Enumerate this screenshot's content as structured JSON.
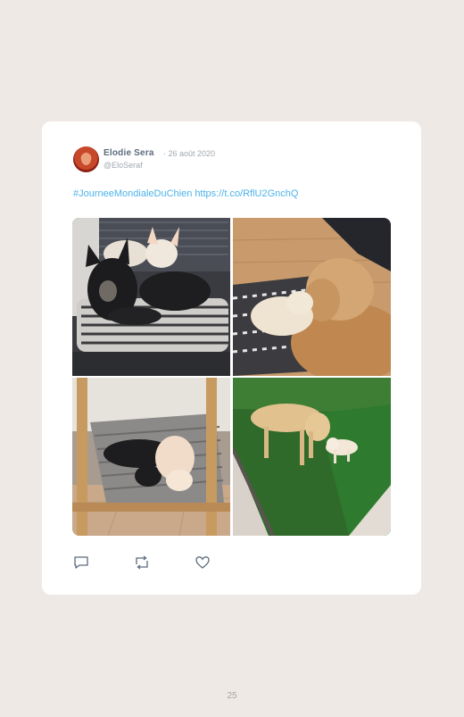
{
  "tweet": {
    "author_name": "Elodie Sera",
    "date": "· 26 août 2020",
    "handle": "@EloSeraf",
    "hashtag": "#JourneeMondialeDuChien",
    "link": "https://t.co/RflU2GnchQ"
  },
  "photos": [
    {
      "name": "photo-two-chihuahuas-on-cushion"
    },
    {
      "name": "photo-chihuahua-and-labrador-on-rug"
    },
    {
      "name": "photo-chihuahuas-on-deck-chair"
    },
    {
      "name": "photo-labrador-and-chihuahua-on-grass"
    }
  ],
  "actions": {
    "reply_icon": "reply-icon",
    "retweet_icon": "retweet-icon",
    "like_icon": "heart-icon"
  },
  "page": {
    "number": "25"
  },
  "colors": {
    "link": "#4db3ea",
    "name": "#5b6b7d",
    "meta": "#a0a8b0",
    "background": "#efe9e6"
  }
}
